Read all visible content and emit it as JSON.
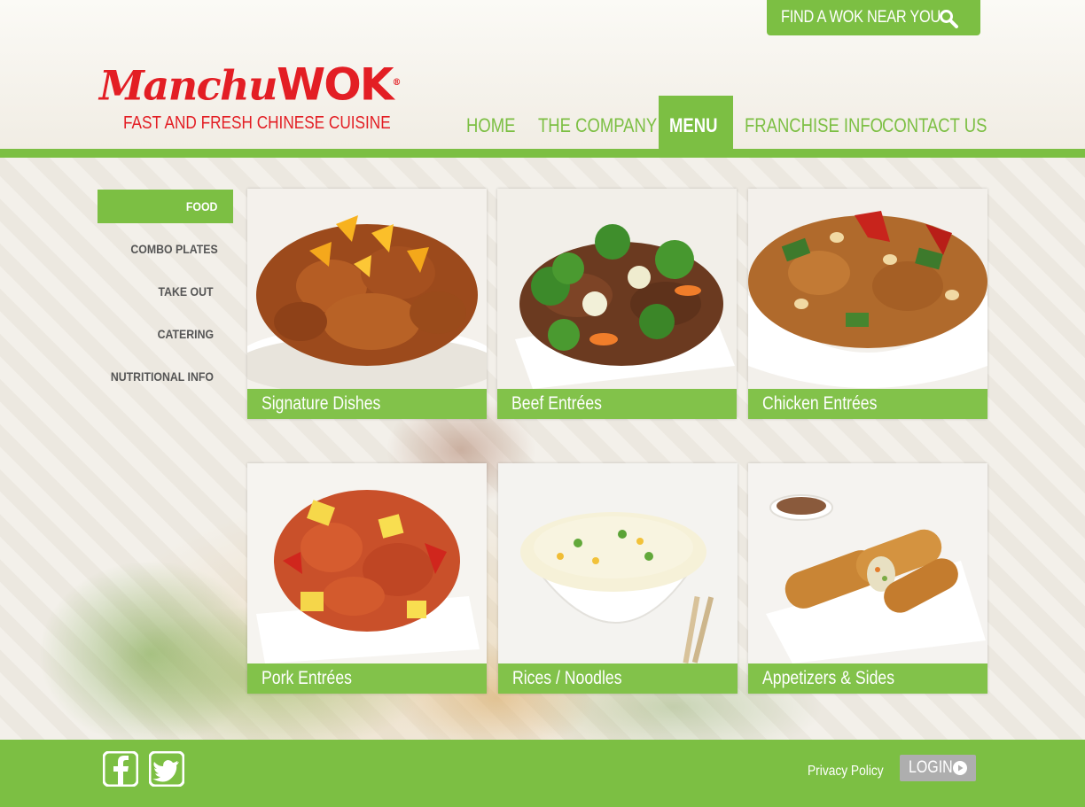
{
  "header": {
    "find_wok_label": "FIND A WOK NEAR YOU",
    "logo_text_main": "Manchu",
    "logo_text_wok": "WOK",
    "logo_reg": "®",
    "tagline": "FAST AND FRESH CHINESE CUISINE",
    "nav": [
      {
        "label": "HOME",
        "active": false
      },
      {
        "label": "THE COMPANY",
        "active": false
      },
      {
        "label": "MENU",
        "active": true
      },
      {
        "label": "FRANCHISE INFO",
        "active": false
      },
      {
        "label": "CONTACT US",
        "active": false
      }
    ]
  },
  "sidebar": {
    "items": [
      {
        "label": "FOOD",
        "active": true
      },
      {
        "label": "COMBO PLATES",
        "active": false
      },
      {
        "label": "TAKE OUT",
        "active": false
      },
      {
        "label": "CATERING",
        "active": false
      },
      {
        "label": "NUTRITIONAL INFO",
        "active": false
      }
    ]
  },
  "menu_tiles": [
    {
      "caption": "Signature Dishes",
      "icon": "orange-chicken-photo"
    },
    {
      "caption": "Beef Entrées",
      "icon": "beef-broccoli-photo"
    },
    {
      "caption": "Chicken Entrées",
      "icon": "kung-pao-chicken-photo"
    },
    {
      "caption": "Pork Entrées",
      "icon": "sweet-sour-pork-photo"
    },
    {
      "caption": "Rices / Noodles",
      "icon": "fried-rice-photo"
    },
    {
      "caption": "Appetizers & Sides",
      "icon": "egg-rolls-photo"
    }
  ],
  "footer": {
    "privacy_label": "Privacy Policy",
    "login_label": "LOGIN",
    "social": [
      "facebook-icon",
      "twitter-icon"
    ]
  },
  "colors": {
    "brand_green": "#7cbf43",
    "brand_red": "#e31e24",
    "login_gray": "#aeaeae"
  }
}
